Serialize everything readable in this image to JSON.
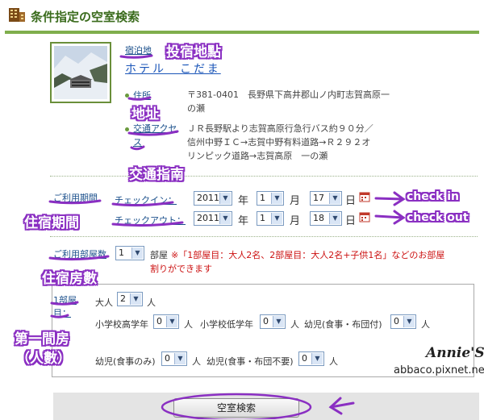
{
  "header": {
    "title": "条件指定の空室検索"
  },
  "hotel": {
    "section_label": "宿泊地",
    "name": "ホテル　こだま",
    "address_label": "住所",
    "address_lines": [
      "〒381-0401　長野県下高井郡山ノ内町志賀高原一",
      "の瀬"
    ],
    "access_label_lines": [
      "交通アクセ",
      "ス"
    ],
    "access_lines": [
      "ＪＲ長野駅より志賀高原行急行バス約９０分／",
      "信州中野ＩＣ→志賀中野有料道路→Ｒ２９２オ",
      "リンピック道路→志賀高原　一の瀬"
    ]
  },
  "period": {
    "label": "ご利用期間",
    "checkin_label": "チェックイン：",
    "checkout_label": "チェックアウト：",
    "checkin": {
      "year": "2011",
      "month": "1",
      "day": "17"
    },
    "checkout": {
      "year": "2011",
      "month": "1",
      "day": "18"
    },
    "year_unit": "年",
    "month_unit": "月",
    "day_unit": "日"
  },
  "rooms": {
    "label": "ご利用部屋数",
    "count": "1",
    "unit": "部屋",
    "note_line1": "※「1部屋目：大人2名、2部屋目：大人2名+子供1名」などのお部屋",
    "note_line2": "割りができます"
  },
  "room1": {
    "label_lines": [
      "1部屋",
      "目："
    ],
    "person_unit": "人",
    "adult_label": "大人",
    "adult_value": "2",
    "elem_high_label": "小学校高学年",
    "elem_high_value": "0",
    "elem_low_label": "小学校低学年",
    "elem_low_value": "0",
    "infant_meal_bed_label": "幼児(食事・布団付)",
    "infant_meal_bed_value": "0",
    "infant_meal_label": "幼児(食事のみ)",
    "infant_meal_value": "0",
    "infant_none_label": "幼児(食事・布団不要)",
    "infant_none_value": "0"
  },
  "search_button": "空室検索",
  "annotations": {
    "place": "投宿地點",
    "address": "地址",
    "access": "交通指南",
    "period": "住宿期間",
    "checkin": "check in",
    "checkout": "check out",
    "rooms": "住宿房數",
    "room1_line1": "第一間房",
    "room1_line2": "（人數）"
  },
  "watermark": {
    "author": "Annie'S",
    "site": "abbaco.pixnet.net"
  },
  "colors": {
    "accent_green": "#7fae4c",
    "annotation_purple": "#8a2fc2",
    "note_red": "#cc1111",
    "link_blue": "#1a55b8"
  }
}
